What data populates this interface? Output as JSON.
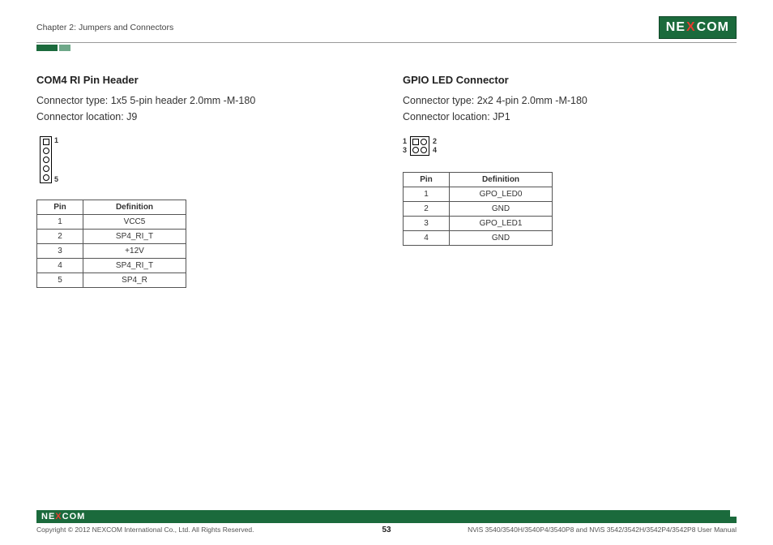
{
  "header": {
    "chapter": "Chapter 2: Jumpers and Connectors",
    "logo_pre": "NE",
    "logo_x": "X",
    "logo_post": "COM"
  },
  "left": {
    "title": "COM4 RI Pin Header",
    "connector_type": "Connector type: 1x5 5-pin header 2.0mm -M-180",
    "connector_location": "Connector location: J9",
    "pin_labels": {
      "top": "1",
      "bottom": "5"
    },
    "table": {
      "headers": [
        "Pin",
        "Definition"
      ],
      "rows": [
        [
          "1",
          "VCC5"
        ],
        [
          "2",
          "SP4_RI_T"
        ],
        [
          "3",
          "+12V"
        ],
        [
          "4",
          "SP4_RI_T"
        ],
        [
          "5",
          "SP4_R"
        ]
      ]
    }
  },
  "right": {
    "title": "GPIO LED Connector",
    "connector_type": "Connector type: 2x2 4-pin 2.0mm -M-180",
    "connector_location": "Connector location: JP1",
    "pin_labels": {
      "tl": "1",
      "tr": "2",
      "bl": "3",
      "br": "4"
    },
    "table": {
      "headers": [
        "Pin",
        "Definition"
      ],
      "rows": [
        [
          "1",
          "GPO_LED0"
        ],
        [
          "2",
          "GND"
        ],
        [
          "3",
          "GPO_LED1"
        ],
        [
          "4",
          "GND"
        ]
      ]
    }
  },
  "footer": {
    "logo_pre": "NE",
    "logo_x": "X",
    "logo_post": "COM",
    "copyright": "Copyright © 2012 NEXCOM International Co., Ltd. All Rights Reserved.",
    "page": "53",
    "product": "NViS 3540/3540H/3540P4/3540P8 and NViS 3542/3542H/3542P4/3542P8 User Manual"
  }
}
